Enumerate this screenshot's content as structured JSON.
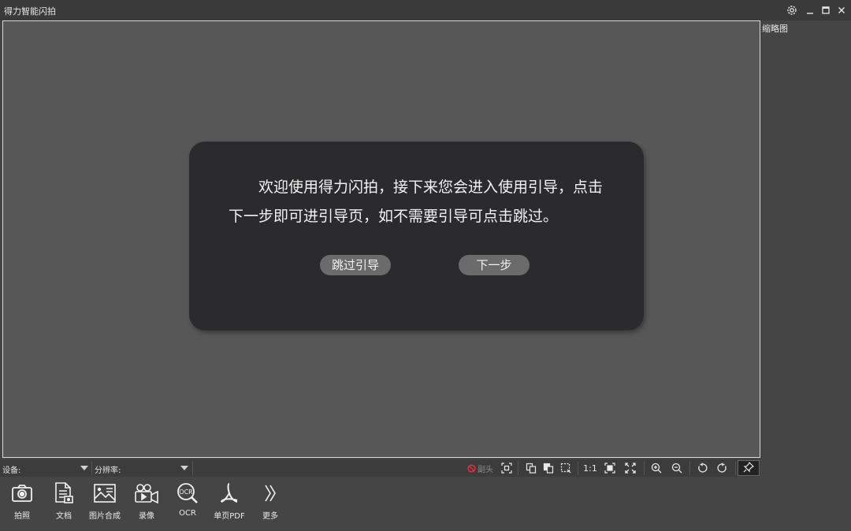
{
  "titlebar": {
    "app_title": "得力智能闪拍",
    "settings_icon": "gear-icon",
    "minimize_icon": "minimize-icon",
    "maximize_icon": "maximize-icon",
    "close_icon": "close-icon"
  },
  "preview": {
    "thumbnail_label": "缩略图"
  },
  "guide_dialog": {
    "message": "欢迎使用得力闪拍，接下来您会进入使用引导，点击下一步即可进引导页，如不需要引导可点击跳过。",
    "skip_label": "跳过引导",
    "next_label": "下一步"
  },
  "device_bar": {
    "device_label": "设备:",
    "resolution_label": "分辨率:",
    "deskew_label": "副头",
    "actual_size_label": "1:1",
    "tools": [
      "crop-auto-icon",
      "copy-icon",
      "merge-icon",
      "select-area-icon",
      "fit-window-icon",
      "fullscreen-icon",
      "zoom-in-icon",
      "zoom-out-icon",
      "rotate-left-icon",
      "rotate-right-icon",
      "pin-icon"
    ]
  },
  "toolbar": {
    "items": [
      {
        "label": "拍照",
        "icon": "camera-icon"
      },
      {
        "label": "文档",
        "icon": "document-icon"
      },
      {
        "label": "图片合成",
        "icon": "image-compose-icon"
      },
      {
        "label": "录像",
        "icon": "video-icon"
      },
      {
        "label": "OCR",
        "icon": "ocr-icon"
      },
      {
        "label": "单页PDF",
        "icon": "pdf-icon"
      },
      {
        "label": "更多",
        "icon": "more-chevron-icon"
      }
    ]
  },
  "colors": {
    "background": "#454545",
    "preview": "#575757",
    "dialog": "#2b2b2d",
    "dialog_button": "#6b6b6b",
    "deskew_icon": "#e0303a"
  }
}
